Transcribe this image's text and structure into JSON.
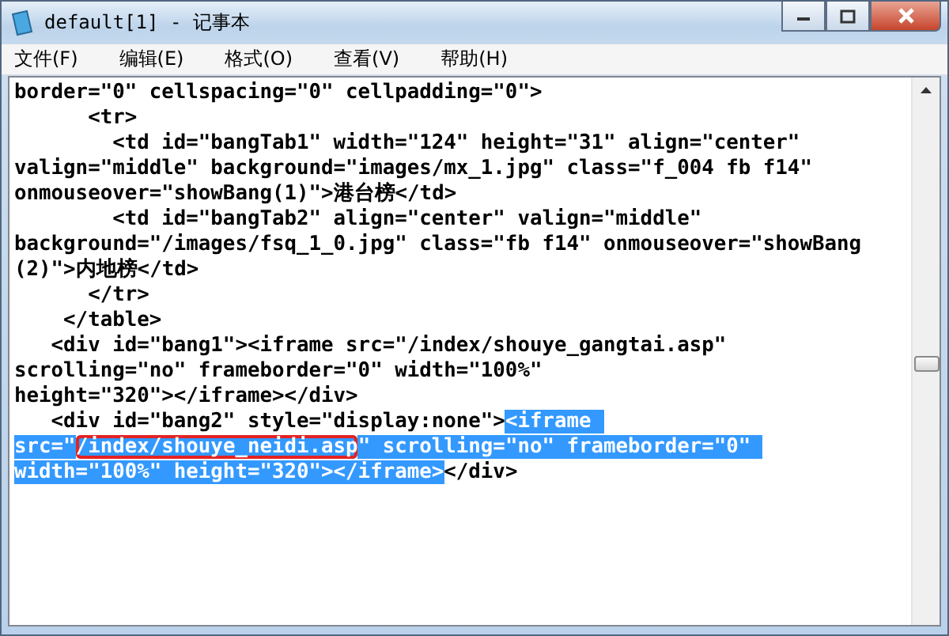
{
  "window": {
    "title": "default[1] - 记事本"
  },
  "menu": [
    {
      "label": "文件(F)"
    },
    {
      "label": "编辑(E)"
    },
    {
      "label": "格式(O)"
    },
    {
      "label": "查看(V)"
    },
    {
      "label": "帮助(H)"
    }
  ],
  "lines": [
    [
      {
        "text": "border=\"0\" cellspacing=\"0\" cellpadding=\"0\">",
        "selected": false
      }
    ],
    [
      {
        "text": "      <tr>",
        "selected": false
      }
    ],
    [
      {
        "text": "        <td id=\"bangTab1\" width=\"124\" height=\"31\" align=\"center\"",
        "selected": false
      }
    ],
    [
      {
        "text": "valign=\"middle\" background=\"images/mx_1.jpg\" class=\"f_004 fb f14\"",
        "selected": false
      }
    ],
    [
      {
        "text": "onmouseover=\"showBang(1)\">港台榜</td>",
        "selected": false
      }
    ],
    [
      {
        "text": "        <td id=\"bangTab2\" align=\"center\" valign=\"middle\"",
        "selected": false
      }
    ],
    [
      {
        "text": "background=\"/images/fsq_1_0.jpg\" class=\"fb f14\" onmouseover=\"showBang",
        "selected": false
      }
    ],
    [
      {
        "text": "(2)\">内地榜</td>",
        "selected": false
      }
    ],
    [
      {
        "text": "      </tr>",
        "selected": false
      }
    ],
    [
      {
        "text": "    </table>",
        "selected": false
      }
    ],
    [
      {
        "text": "   <div id=\"bang1\"><iframe src=\"/index/shouye_gangtai.asp\"",
        "selected": false
      }
    ],
    [
      {
        "text": "scrolling=\"no\" frameborder=\"0\" width=\"100%\"",
        "selected": false
      }
    ],
    [
      {
        "text": "height=\"320\"></iframe></div>",
        "selected": false
      }
    ],
    [
      {
        "text": "   <div id=\"bang2\" style=\"display:none\">",
        "selected": false
      },
      {
        "text": "<iframe ",
        "selected": true
      }
    ],
    [
      {
        "text": "src=\"",
        "selected": true
      },
      {
        "text": "/index/shouye_neidi.asp",
        "selected": true,
        "circled": true
      },
      {
        "text": "\" scrolling=\"no\" frameborder=\"0\" ",
        "selected": true
      }
    ],
    [
      {
        "text": "width=\"100%\" height=\"320\"></iframe>",
        "selected": true
      },
      {
        "text": "</div>",
        "selected": false
      }
    ]
  ]
}
